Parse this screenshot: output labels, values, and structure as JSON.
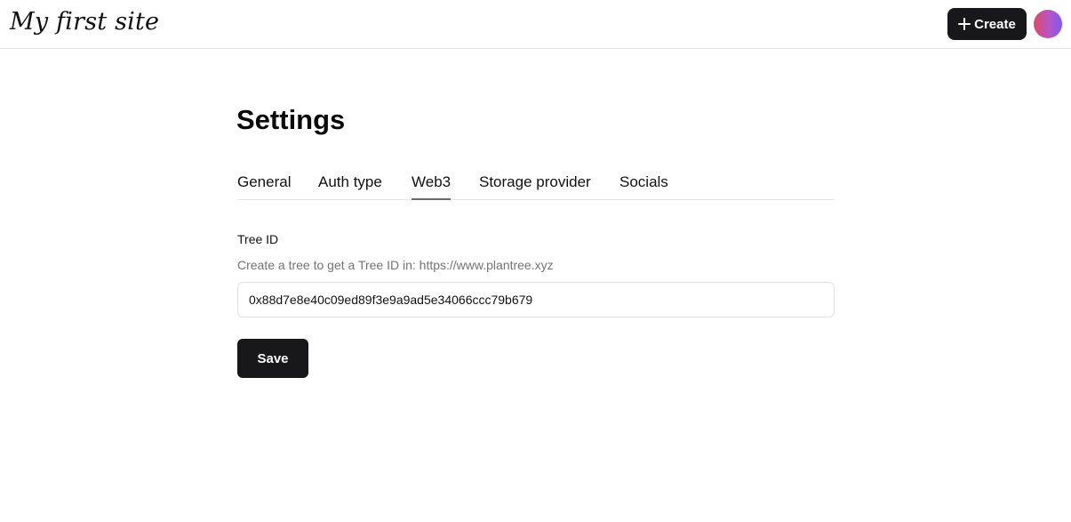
{
  "header": {
    "site_title": "My first site",
    "create_label": "Create"
  },
  "main": {
    "title": "Settings",
    "tabs": [
      {
        "label": "General",
        "active": false
      },
      {
        "label": "Auth type",
        "active": false
      },
      {
        "label": "Web3",
        "active": true
      },
      {
        "label": "Storage provider",
        "active": false
      },
      {
        "label": "Socials",
        "active": false
      }
    ],
    "field": {
      "label": "Tree ID",
      "help": "Create a tree to get a Tree ID in: https://www.plantree.xyz",
      "value": "0x88d7e8e40c09ed89f3e9a9ad5e34066ccc79b679"
    },
    "save_label": "Save"
  },
  "colors": {
    "button_bg": "#18181b",
    "help_text": "#737373",
    "avatar_gradient": [
      "#e04a6b",
      "#7a5cf0"
    ]
  },
  "icons": {
    "create": "plus-icon"
  }
}
